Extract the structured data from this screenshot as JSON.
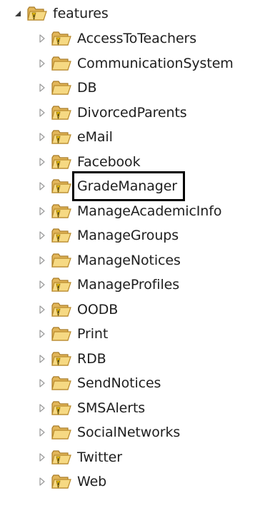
{
  "tree": {
    "root": {
      "label": "features",
      "expanded": true,
      "icon": "package-folder-warning-icon"
    },
    "children": [
      {
        "label": "AccessToTeachers",
        "warning": true,
        "selected": false
      },
      {
        "label": "CommunicationSystem",
        "warning": false,
        "selected": false
      },
      {
        "label": "DB",
        "warning": false,
        "selected": false
      },
      {
        "label": "DivorcedParents",
        "warning": true,
        "selected": false
      },
      {
        "label": "eMail",
        "warning": true,
        "selected": false
      },
      {
        "label": "Facebook",
        "warning": true,
        "selected": false
      },
      {
        "label": "GradeManager",
        "warning": true,
        "selected": true
      },
      {
        "label": "ManageAcademicInfo",
        "warning": true,
        "selected": false
      },
      {
        "label": "ManageGroups",
        "warning": true,
        "selected": false
      },
      {
        "label": "ManageNotices",
        "warning": false,
        "selected": false
      },
      {
        "label": "ManageProfiles",
        "warning": true,
        "selected": false
      },
      {
        "label": "OODB",
        "warning": true,
        "selected": false
      },
      {
        "label": "Print",
        "warning": false,
        "selected": false
      },
      {
        "label": "RDB",
        "warning": true,
        "selected": false
      },
      {
        "label": "SendNotices",
        "warning": false,
        "selected": false
      },
      {
        "label": "SMSAlerts",
        "warning": true,
        "selected": false
      },
      {
        "label": "SocialNetworks",
        "warning": false,
        "selected": false
      },
      {
        "label": "Twitter",
        "warning": true,
        "selected": false
      },
      {
        "label": "Web",
        "warning": true,
        "selected": false
      }
    ]
  },
  "colors": {
    "folder_fill": "#f3d27a",
    "folder_stroke": "#b8892a",
    "warning_fill": "#f5c400",
    "selection_outline": "#000000",
    "arrow_collapsed": "#9a9a9a",
    "arrow_expanded": "#3c3c3c"
  }
}
